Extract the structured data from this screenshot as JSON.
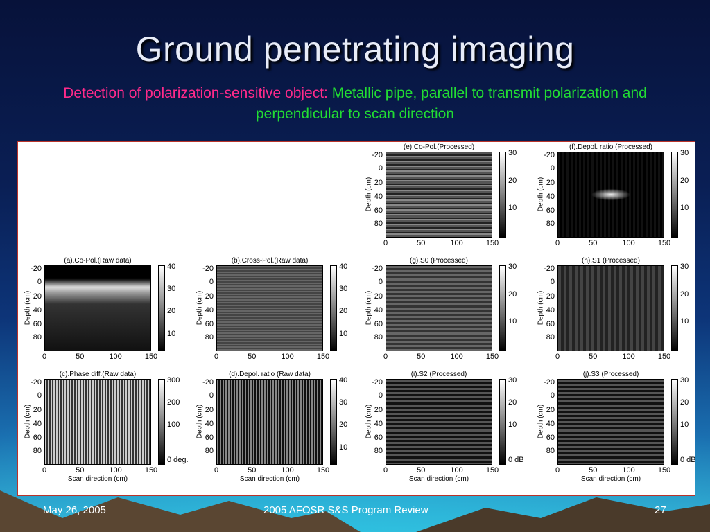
{
  "slide": {
    "title": "Ground penetrating imaging",
    "subtitle_prefix": "Detection of polarization-sensitive object:",
    "subtitle_highlight": "Metallic pipe, parallel to transmit polarization and perpendicular to scan direction"
  },
  "figure": {
    "y_label": "Depth (cm)",
    "x_label": "Scan direction (cm)",
    "y_ticks": [
      "-20",
      "0",
      "20",
      "40",
      "60",
      "80"
    ],
    "x_ticks": [
      "0",
      "50",
      "100",
      "150"
    ],
    "panels": [
      {
        "id": "e",
        "title": "(e).Co-Pol.(Processed)",
        "cticks": [
          "30",
          "20",
          "10"
        ]
      },
      {
        "id": "f",
        "title": "(f).Depol. ratio (Processed)",
        "cticks": [
          "30",
          "20",
          "10"
        ]
      },
      {
        "id": "a",
        "title": "(a).Co-Pol.(Raw data)",
        "cticks": [
          "40",
          "30",
          "20",
          "10"
        ]
      },
      {
        "id": "b",
        "title": "(b).Cross-Pol.(Raw data)",
        "cticks": [
          "40",
          "30",
          "20",
          "10"
        ]
      },
      {
        "id": "g",
        "title": "(g).S0 (Processed)",
        "cticks": [
          "30",
          "20",
          "10"
        ]
      },
      {
        "id": "h",
        "title": "(h).S1 (Processed)",
        "cticks": [
          "30",
          "20",
          "10"
        ]
      },
      {
        "id": "c",
        "title": "(c).Phase diff.(Raw data)",
        "cticks": [
          "300",
          "200",
          "100",
          "0 deg."
        ]
      },
      {
        "id": "d",
        "title": "(d).Depol. ratio (Raw data)",
        "cticks": [
          "40",
          "30",
          "20",
          "10"
        ]
      },
      {
        "id": "i",
        "title": "(i).S2 (Processed)",
        "cticks": [
          "30",
          "20",
          "10",
          "0 dB"
        ]
      },
      {
        "id": "j",
        "title": "(j).S3 (Processed)",
        "cticks": [
          "30",
          "20",
          "10",
          "0 dB"
        ]
      }
    ]
  },
  "footer": {
    "date": "May 26, 2005",
    "event": "2005 AFOSR S&S Program Review",
    "page": "27"
  }
}
